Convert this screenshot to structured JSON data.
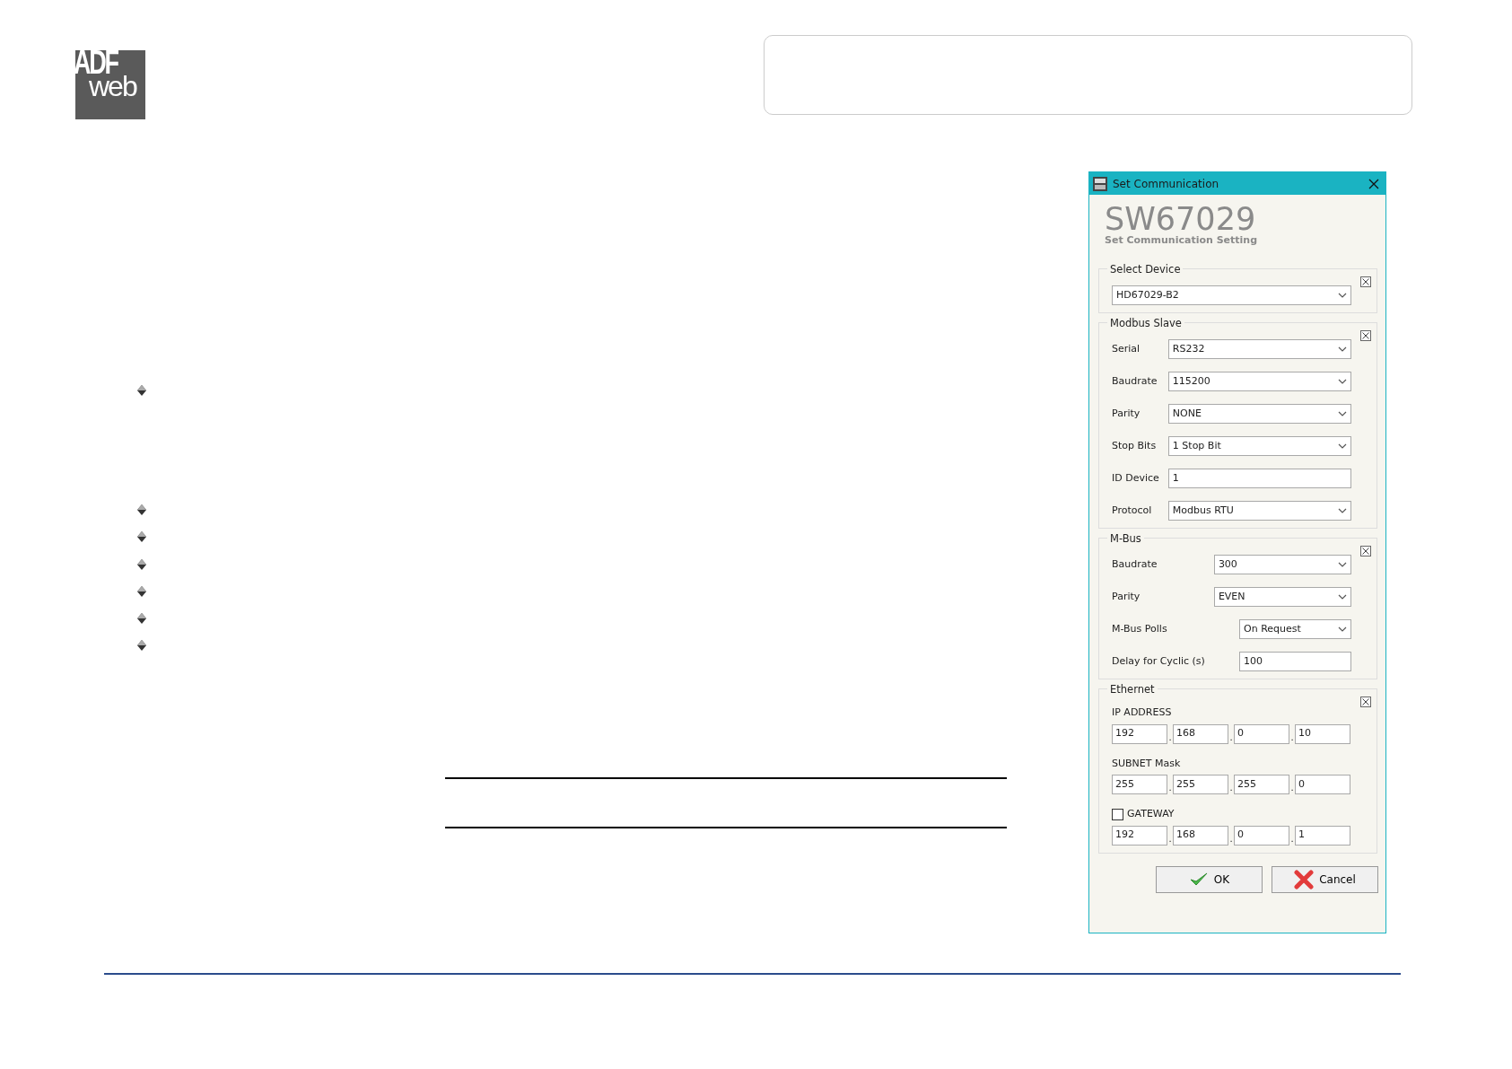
{
  "logo": {
    "top": "ADF",
    "bottom": "web"
  },
  "dialog": {
    "title": "Set Communication",
    "heading": "SW67029",
    "subheading": "Set Communication Setting",
    "groups": [
      {
        "title": "Select Device",
        "rows": [
          {
            "kind": "select",
            "value": "HD67029-B2"
          }
        ]
      },
      {
        "title": "Modbus Slave",
        "rows": [
          {
            "kind": "select",
            "label": "Serial",
            "value": "RS232"
          },
          {
            "kind": "select",
            "label": "Baudrate",
            "value": "115200"
          },
          {
            "kind": "select",
            "label": "Parity",
            "value": "NONE"
          },
          {
            "kind": "select",
            "label": "Stop Bits",
            "value": "1 Stop Bit"
          },
          {
            "kind": "input",
            "label": "ID Device",
            "value": "1"
          },
          {
            "kind": "select",
            "label": "Protocol",
            "value": "Modbus RTU"
          }
        ]
      },
      {
        "title": "M-Bus",
        "rows": [
          {
            "kind": "select",
            "label": "Baudrate",
            "value": "300"
          },
          {
            "kind": "select",
            "label": "Parity",
            "value": "EVEN"
          },
          {
            "kind": "select",
            "label": "M-Bus Polls",
            "value": "On Request",
            "short": true
          },
          {
            "kind": "input",
            "label": "Delay for Cyclic (s)",
            "value": "100",
            "short": true
          }
        ]
      },
      {
        "title": "Ethernet",
        "rows": [
          {
            "kind": "ip",
            "label": "IP ADDRESS",
            "octets": [
              "192",
              "168",
              "0",
              "10"
            ],
            "separators": [
              ".",
              ".",
              "."
            ]
          },
          {
            "kind": "ip",
            "label": "SUBNET Mask",
            "octets": [
              "255",
              "255",
              "255",
              "0"
            ],
            "separators": [
              ".",
              ".",
              "."
            ]
          },
          {
            "kind": "ip_check",
            "label": "GATEWAY",
            "checked": false,
            "octets": [
              "192",
              "168",
              "0",
              "1"
            ],
            "separators": [
              ".",
              ".",
              "."
            ]
          }
        ]
      }
    ],
    "buttons": [
      {
        "kind": "ok",
        "label": "OK"
      },
      {
        "kind": "cancel",
        "label": "Cancel"
      }
    ]
  }
}
